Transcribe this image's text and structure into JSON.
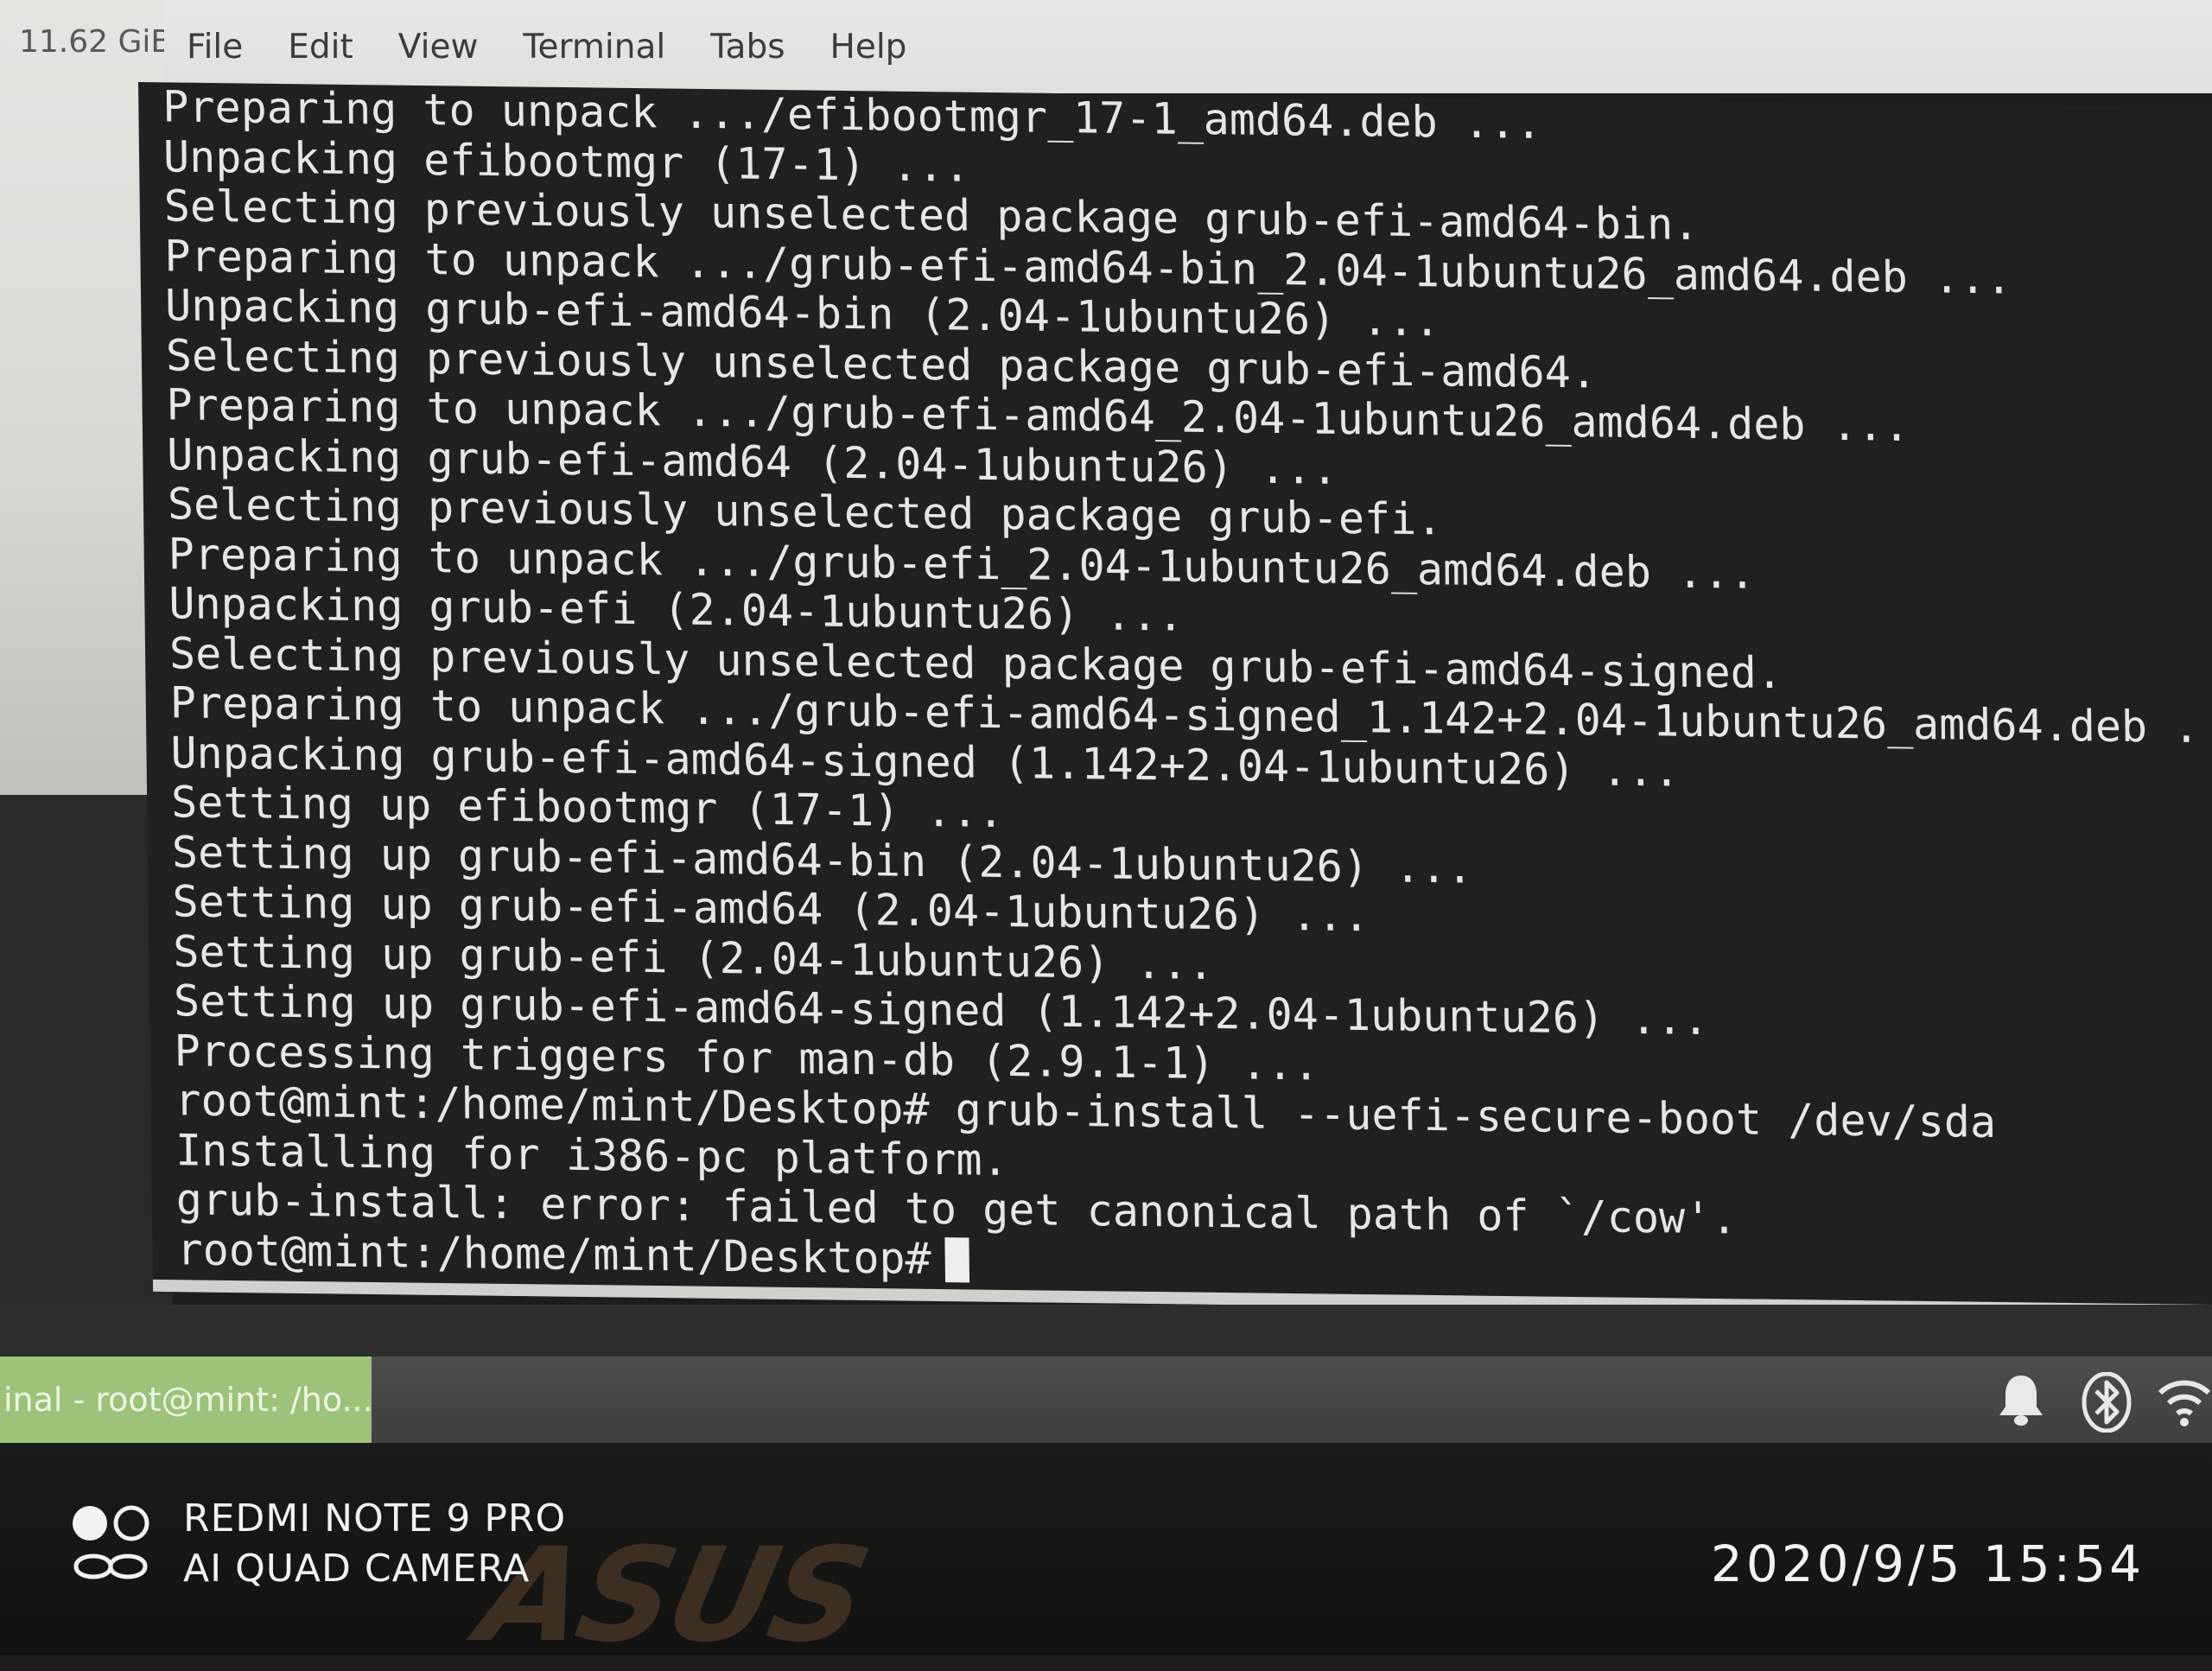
{
  "desktop": {
    "label": "11.62 GiB"
  },
  "menubar": {
    "items": [
      "File",
      "Edit",
      "View",
      "Terminal",
      "Tabs",
      "Help"
    ]
  },
  "terminal": {
    "lines": [
      "Preparing to unpack .../efibootmgr_17-1_amd64.deb ...",
      "Unpacking efibootmgr (17-1) ...",
      "Selecting previously unselected package grub-efi-amd64-bin.",
      "Preparing to unpack .../grub-efi-amd64-bin_2.04-1ubuntu26_amd64.deb ...",
      "Unpacking grub-efi-amd64-bin (2.04-1ubuntu26) ...",
      "Selecting previously unselected package grub-efi-amd64.",
      "Preparing to unpack .../grub-efi-amd64_2.04-1ubuntu26_amd64.deb ...",
      "Unpacking grub-efi-amd64 (2.04-1ubuntu26) ...",
      "Selecting previously unselected package grub-efi.",
      "Preparing to unpack .../grub-efi_2.04-1ubuntu26_amd64.deb ...",
      "Unpacking grub-efi (2.04-1ubuntu26) ...",
      "Selecting previously unselected package grub-efi-amd64-signed.",
      "Preparing to unpack .../grub-efi-amd64-signed_1.142+2.04-1ubuntu26_amd64.deb .",
      "Unpacking grub-efi-amd64-signed (1.142+2.04-1ubuntu26) ...",
      "Setting up efibootmgr (17-1) ...",
      "Setting up grub-efi-amd64-bin (2.04-1ubuntu26) ...",
      "Setting up grub-efi-amd64 (2.04-1ubuntu26) ...",
      "Setting up grub-efi (2.04-1ubuntu26) ...",
      "Setting up grub-efi-amd64-signed (1.142+2.04-1ubuntu26) ...",
      "Processing triggers for man-db (2.9.1-1) ...",
      "root@mint:/home/mint/Desktop# grub-install --uefi-secure-boot /dev/sda",
      "Installing for i386-pc platform.",
      "grub-install: error: failed to get canonical path of `/cow'."
    ],
    "prompt": "root@mint:/home/mint/Desktop#"
  },
  "taskbar": {
    "window_label": "inal - root@mint: /ho...",
    "tray_icons": [
      "bell-icon",
      "bluetooth-icon",
      "wifi-icon"
    ]
  },
  "bezel": {
    "brand": "ASUS"
  },
  "watermark": {
    "model": "REDMI NOTE 9 PRO",
    "camera": "AI QUAD CAMERA",
    "datetime": "2020/9/5  15:54"
  }
}
